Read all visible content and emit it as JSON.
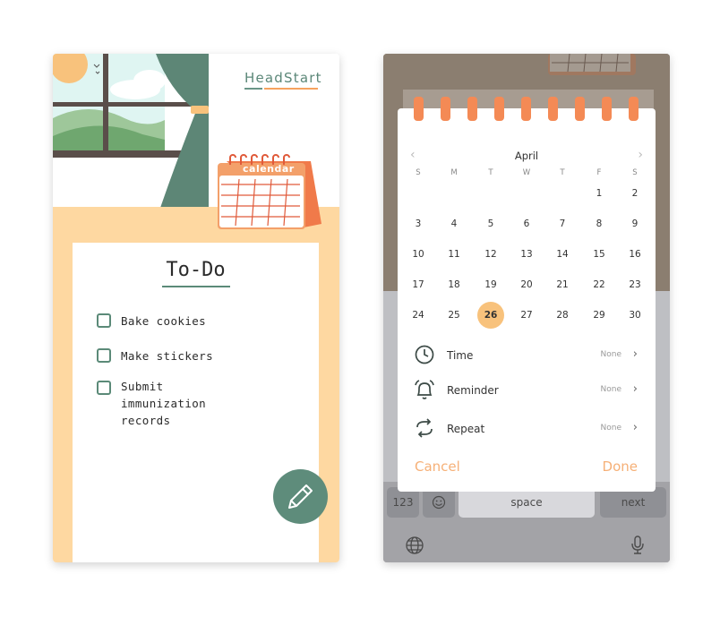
{
  "left": {
    "brand": "HeadStart",
    "calendar_label": "calendar",
    "title": "To-Do",
    "tasks": [
      {
        "label": "Bake cookies",
        "checked": false
      },
      {
        "label": "Make stickers",
        "checked": false
      },
      {
        "label": "Submit immunization records",
        "checked": false
      }
    ],
    "fab_icon": "pencil-icon"
  },
  "right": {
    "calendar": {
      "month": "April",
      "weekdays": [
        "S",
        "M",
        "T",
        "W",
        "T",
        "F",
        "S"
      ],
      "weeks": [
        [
          "",
          "",
          "",
          "",
          "",
          "1",
          "2"
        ],
        [
          "3",
          "4",
          "5",
          "6",
          "7",
          "8",
          "9"
        ],
        [
          "10",
          "11",
          "12",
          "13",
          "14",
          "15",
          "16"
        ],
        [
          "17",
          "18",
          "19",
          "20",
          "21",
          "22",
          "23"
        ],
        [
          "24",
          "25",
          "26",
          "27",
          "28",
          "29",
          "30"
        ]
      ],
      "selected_day": "26"
    },
    "options": [
      {
        "label": "Time",
        "value": "None",
        "icon": "clock-icon"
      },
      {
        "label": "Reminder",
        "value": "None",
        "icon": "bell-icon"
      },
      {
        "label": "Repeat",
        "value": "None",
        "icon": "repeat-icon"
      }
    ],
    "cancel_label": "Cancel",
    "done_label": "Done",
    "keyboard": {
      "num_key": "123",
      "space_key": "space",
      "next_key": "next",
      "emoji_icon": "emoji-icon",
      "globe_icon": "globe-icon",
      "mic_icon": "microphone-icon"
    }
  },
  "colors": {
    "accent_orange": "#f6a25e",
    "teal": "#5e8c7b",
    "peach": "#fed8a1",
    "selected_day": "#f8c27c"
  }
}
